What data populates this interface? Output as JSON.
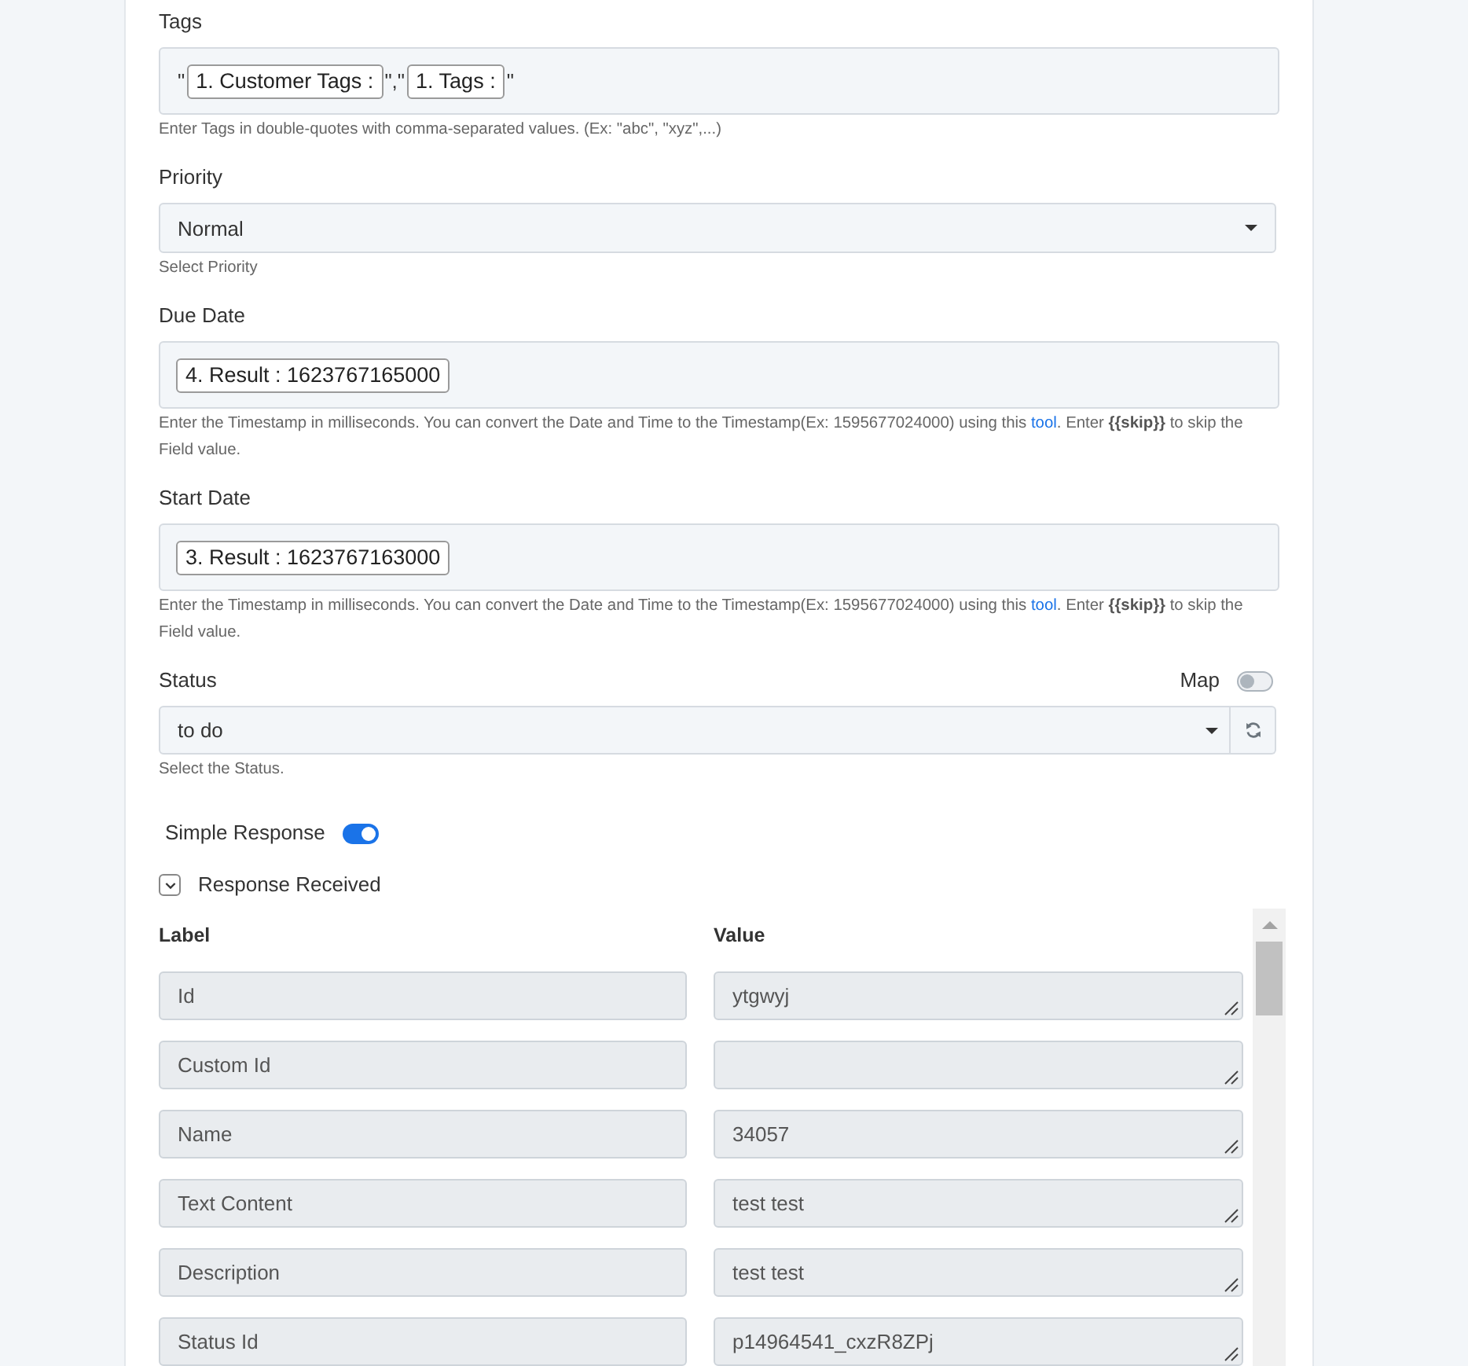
{
  "fields": [
    {
      "kind": "tokens",
      "label": "Tags",
      "tokens": [
        {
          "kind": "text",
          "text": "\""
        },
        {
          "kind": "chip",
          "text": "1. Customer Tags :"
        },
        {
          "kind": "text",
          "text": "\",\""
        },
        {
          "kind": "chip",
          "text": "1. Tags :"
        },
        {
          "kind": "text",
          "text": "\""
        }
      ],
      "hint": [
        {
          "kind": "text",
          "text": "Enter Tags in double-quotes with comma-separated values. (Ex: \"abc\", \"xyz\",...)"
        }
      ]
    },
    {
      "kind": "select",
      "label": "Priority",
      "value": "Normal",
      "hint": [
        {
          "kind": "text",
          "text": "Select Priority"
        }
      ]
    },
    {
      "kind": "tokens",
      "label": "Due Date",
      "tokens": [
        {
          "kind": "chip",
          "text": "4. Result : 1623767165000"
        }
      ],
      "hint": [
        {
          "kind": "text",
          "text": "Enter the Timestamp in milliseconds. You can convert the Date and Time to the Timestamp(Ex: 1595677024000) using this "
        },
        {
          "kind": "link",
          "text": "tool"
        },
        {
          "kind": "text",
          "text": ". Enter **{{skip}}** to skip the Field value."
        }
      ]
    },
    {
      "kind": "tokens",
      "label": "Start Date",
      "tokens": [
        {
          "kind": "chip",
          "text": "3. Result : 1623767163000"
        }
      ],
      "hint": [
        {
          "kind": "text",
          "text": "Enter the Timestamp in milliseconds. You can convert the Date and Time to the Timestamp(Ex: 1595677024000) using this "
        },
        {
          "kind": "link",
          "text": "tool"
        },
        {
          "kind": "text",
          "text": ". Enter **{{skip}}** to skip the Field value."
        }
      ]
    },
    {
      "kind": "select",
      "label": "Status",
      "value": "to do",
      "map": {
        "label": "Map",
        "on": false
      },
      "refresh_button": true,
      "hint": [
        {
          "kind": "text",
          "text": "Select the Status."
        }
      ]
    }
  ],
  "simple_response": {
    "label": "Simple Response",
    "on": true
  },
  "response": {
    "title": "Response Received",
    "expanded": true,
    "columns": [
      "Label",
      "Value"
    ],
    "rows": [
      {
        "label": "Id",
        "value": "ytgwyj"
      },
      {
        "label": "Custom Id"
      },
      {
        "label": "Name",
        "value": "34057"
      },
      {
        "label": "Text Content",
        "value": "test test"
      },
      {
        "label": "Description",
        "value": "test test"
      },
      {
        "label": "Status Id",
        "value": "p14964541_cxzR8ZPj"
      }
    ]
  }
}
